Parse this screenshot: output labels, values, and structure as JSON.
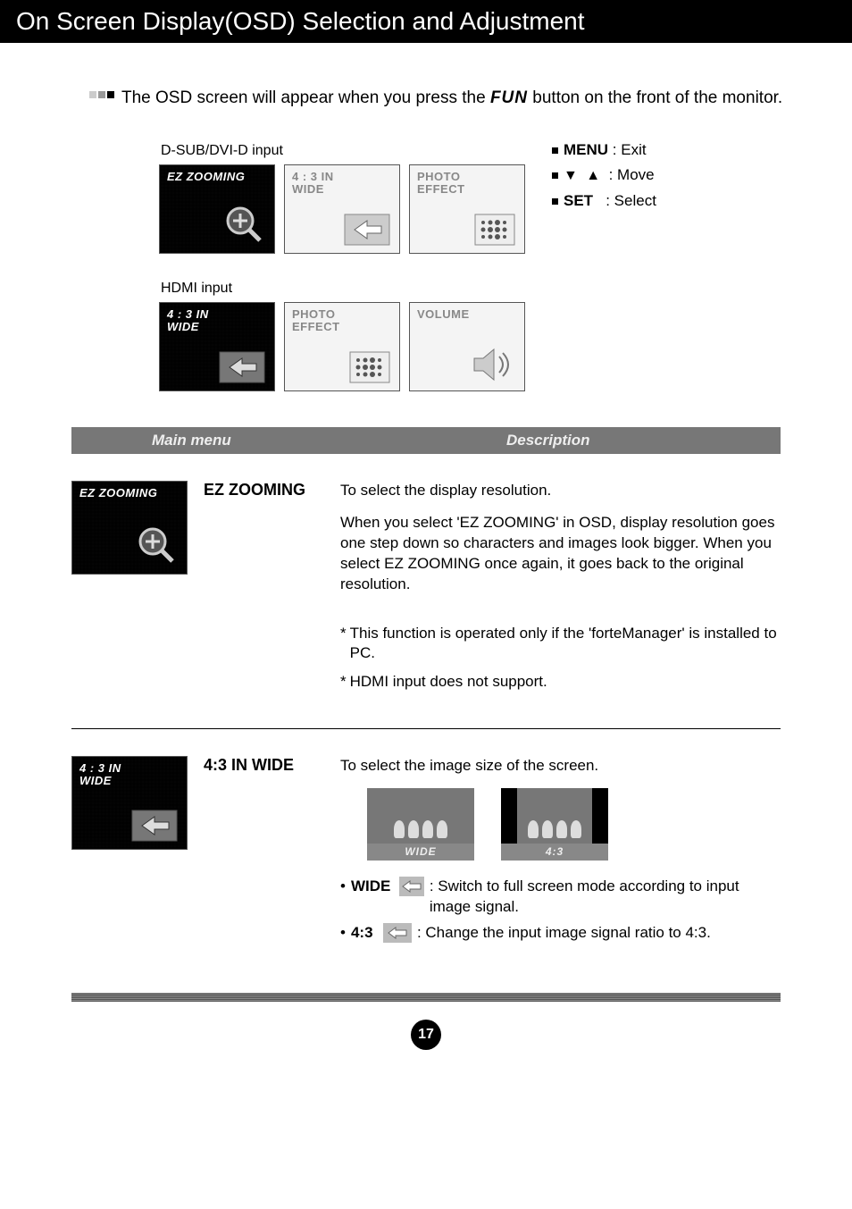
{
  "title": "On Screen Display(OSD) Selection and Adjustment",
  "intro": {
    "line": "The OSD screen will appear when you press the ",
    "fun": "FUN",
    "line_after": " button on the front of the monitor."
  },
  "inputs": {
    "dsub_label": "D-SUB/DVI-D input",
    "hdmi_label": "HDMI input"
  },
  "tiles": {
    "ez_zooming": "EZ ZOOMING",
    "ratio": "4 : 3 IN\nWIDE",
    "photo": "PHOTO\nEFFECT",
    "volume": "VOLUME"
  },
  "legend": {
    "menu_label": "MENU",
    "menu_desc": ": Exit",
    "move_desc": ": Move",
    "set_label": "SET",
    "set_desc": ": Select"
  },
  "section": {
    "main": "Main menu",
    "desc": "Description"
  },
  "ez": {
    "name": "EZ ZOOMING",
    "p1": "To select the display resolution.",
    "p2": "When you select 'EZ ZOOMING' in OSD, display resolution goes one step down so characters and images look bigger. When you select EZ ZOOMING once again, it goes back to the original resolution.",
    "note1": "This function is operated only if the 'forteManager' is installed to PC.",
    "note2": "HDMI input does not support."
  },
  "ratio": {
    "name": "4:3 IN WIDE",
    "p1": "To select the image size of the screen.",
    "wide_label": "WIDE",
    "narrow_label": "4:3",
    "wide_name": "WIDE",
    "wide_desc": ": Switch to full screen mode according to input image signal.",
    "narrow_name": "4:3",
    "narrow_desc": ": Change the input image signal ratio to 4:3."
  },
  "page_number": "17"
}
